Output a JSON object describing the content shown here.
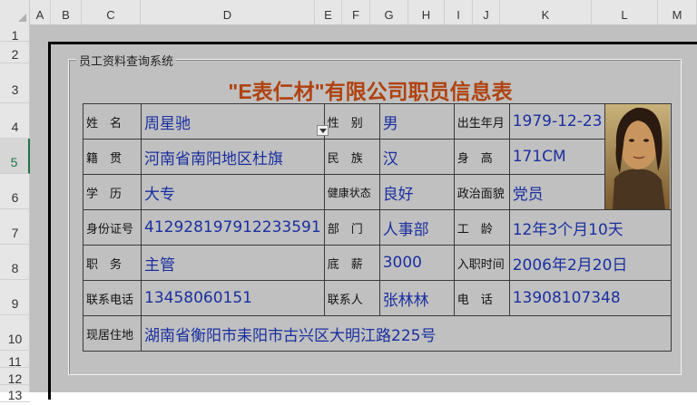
{
  "columns": [
    "A",
    "B",
    "C",
    "D",
    "E",
    "F",
    "G",
    "H",
    "I",
    "J",
    "K",
    "L",
    "M"
  ],
  "rows": [
    "1",
    "2",
    "3",
    "4",
    "5",
    "6",
    "7",
    "8",
    "9",
    "10",
    "11",
    "12",
    "13"
  ],
  "group_title": "员工资料查询系统",
  "form_title": "\"E表仁材\"有限公司职员信息表",
  "fields": {
    "name_label": "姓　名",
    "name": "周星驰",
    "gender_label": "性　别",
    "gender": "男",
    "birth_label": "出生年月",
    "birth": "1979-12-23",
    "native_label": "籍　贯",
    "native": "河南省南阳地区杜旗",
    "ethnic_label": "民　族",
    "ethnic": "汉",
    "height_label": "身　高",
    "height": "171CM",
    "edu_label": "学　历",
    "edu": "大专",
    "health_label": "健康状态",
    "health": "良好",
    "political_label": "政治面貌",
    "political": "党员",
    "id_label": "身份证号",
    "id": "412928197912233591",
    "dept_label": "部　门",
    "dept": "人事部",
    "seniority_label": "工　龄",
    "seniority": "12年3个月10天",
    "position_label": "职　务",
    "position": "主管",
    "salary_label": "底　薪",
    "salary": "3000",
    "hire_label": "入职时间",
    "hire": "2006年2月20日",
    "phone_label": "联系电话",
    "phone": "13458060151",
    "contact_label": "联系人",
    "contact": "张林林",
    "tel_label": "电　话",
    "tel": "13908107348",
    "address_label": "现居住地",
    "address": "湖南省衡阳市耒阳市古兴区大明江路225号"
  },
  "colors": {
    "title": "#b0420f",
    "value": "#1a2fa0",
    "sheet_bg": "#c0c0c0",
    "selected_row": "#217346"
  },
  "icons": {
    "photo": "employee-photo",
    "dropdown": "dropdown-arrow-icon"
  }
}
